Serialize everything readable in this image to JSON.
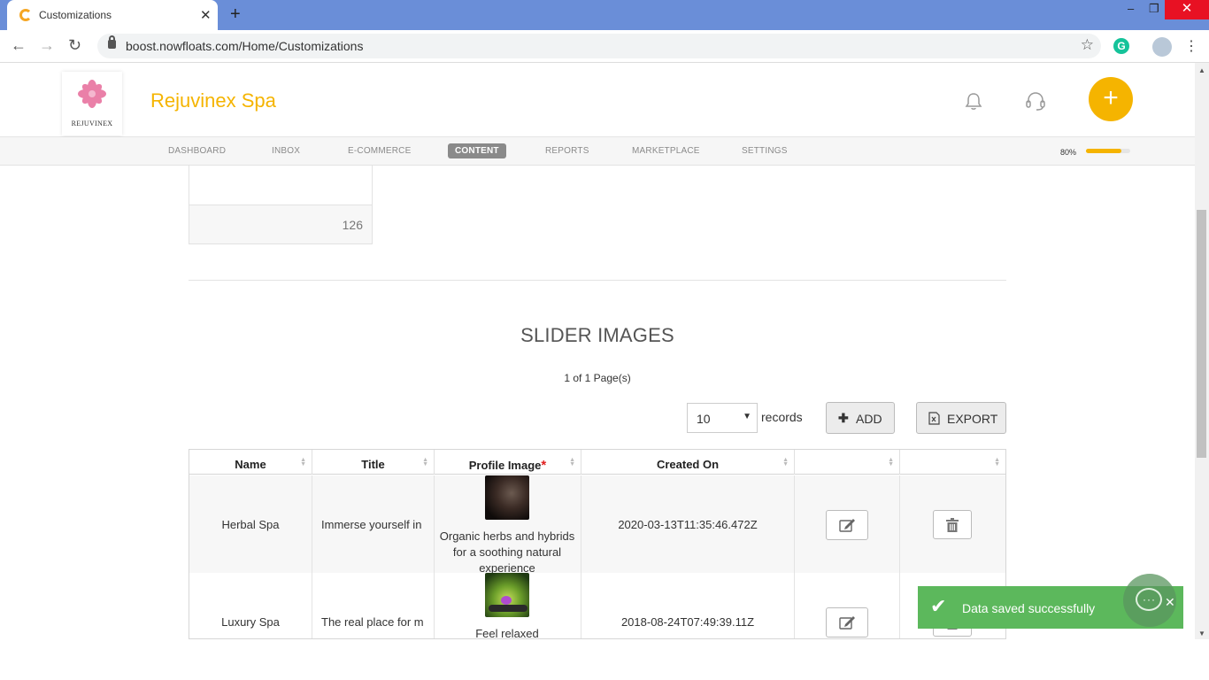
{
  "browser": {
    "tab_title": "Customizations",
    "close_tab": "✕",
    "new_tab": "+",
    "url": "boost.nowfloats.com/Home/Customizations",
    "extension_letter": "G",
    "minimize": "–",
    "restore": "❐",
    "close_window": "✕"
  },
  "header": {
    "logo_text": "REJUVINEX",
    "brand_name": "Rejuvinex Spa",
    "add_label": "+"
  },
  "nav": {
    "items": [
      {
        "label": "DASHBOARD"
      },
      {
        "label": "INBOX"
      },
      {
        "label": "E-COMMERCE"
      },
      {
        "label": "CONTENT"
      },
      {
        "label": "REPORTS"
      },
      {
        "label": "MARKETPLACE"
      },
      {
        "label": "SETTINGS"
      }
    ],
    "active": "CONTENT",
    "progress_label": "80%",
    "progress_value": 0.8
  },
  "card": {
    "count": "126"
  },
  "slider_images": {
    "title": "SLIDER IMAGES",
    "pager_text": "1 of 1 Page(s)",
    "records_value": "10",
    "records_label": "records",
    "add_label": "ADD",
    "export_label": "EXPORT",
    "columns": [
      "Name",
      "Title",
      "Profile Image",
      "Created On",
      "",
      ""
    ],
    "required_mark": "*",
    "rows": [
      {
        "name": "Herbal Spa",
        "title": "Immerse yourself in",
        "image_desc": "Organic herbs and hybrids for a soothing natural experience",
        "created_on": "2020-03-13T11:35:46.472Z"
      },
      {
        "name": "Luxury Spa",
        "title": "The real place for m",
        "image_desc": "Feel relaxed",
        "created_on": "2018-08-24T07:49:39.11Z"
      }
    ]
  },
  "toast": {
    "message": "Data saved successfully",
    "close": "✕",
    "check": "✔"
  },
  "colors": {
    "accent": "#f5b400",
    "toast": "#5cb85c",
    "chrome_tabbar": "#6a8ed8"
  }
}
